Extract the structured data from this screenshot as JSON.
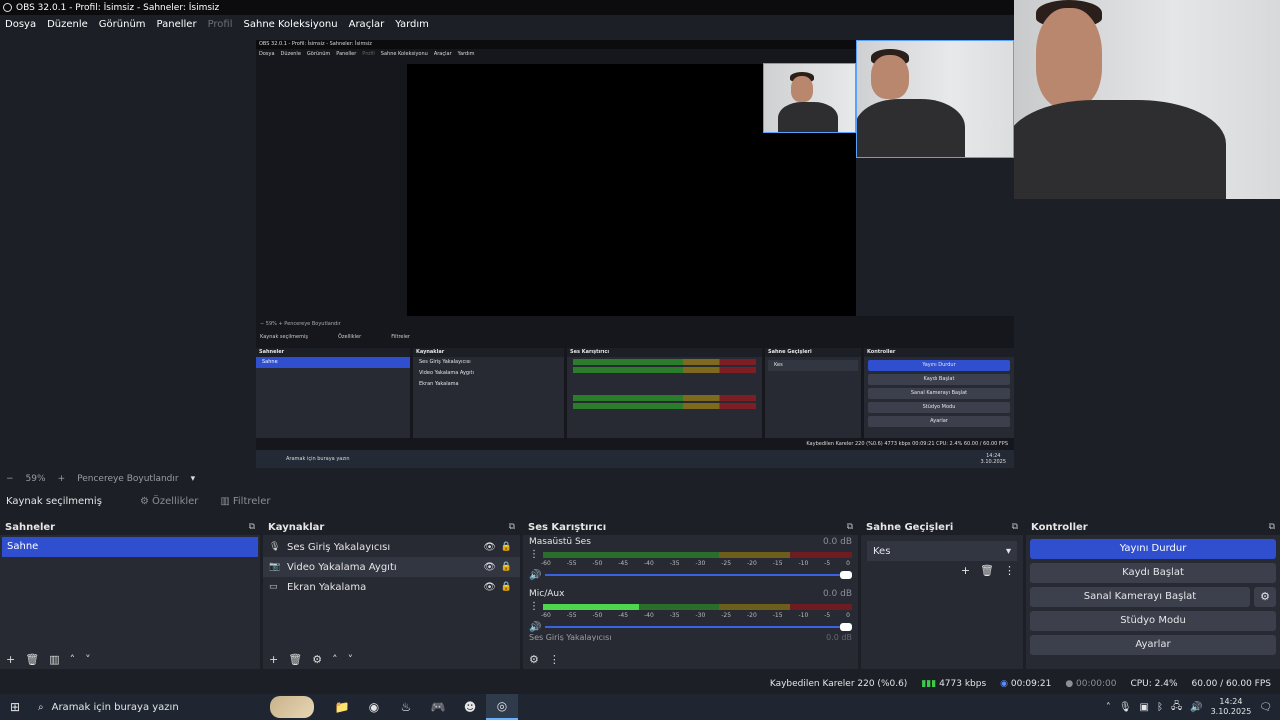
{
  "window": {
    "title": "OBS 32.0.1 - Profil: İsimsiz - Sahneler: İsimsiz"
  },
  "menu": {
    "items": [
      {
        "label": "Dosya",
        "disabled": false
      },
      {
        "label": "Düzenle",
        "disabled": false
      },
      {
        "label": "Görünüm",
        "disabled": false
      },
      {
        "label": "Paneller",
        "disabled": false
      },
      {
        "label": "Profil",
        "disabled": true
      },
      {
        "label": "Sahne Koleksiyonu",
        "disabled": false
      },
      {
        "label": "Araçlar",
        "disabled": false
      },
      {
        "label": "Yardım",
        "disabled": false
      }
    ]
  },
  "nested": {
    "title": "OBS 32.0.1 - Profil: İsimsiz - Sahneler: İsimsiz",
    "menu": [
      "Dosya",
      "Düzenle",
      "Görünüm",
      "Paneller",
      "Profil",
      "Sahne Koleksiyonu",
      "Araçlar",
      "Yardım"
    ],
    "zoom": "59%",
    "zoom_label": "Pencereye Boyutlandır",
    "no_source": "Kaynak seçilmemiş",
    "properties": "Özellikler",
    "filters": "Filtreler",
    "scenes_title": "Sahneler",
    "scene": "Sahne",
    "sources_title": "Kaynaklar",
    "sources": [
      "Ses Giriş Yakalayıcısı",
      "Video Yakalama Aygıtı",
      "Ekran Yakalama"
    ],
    "mixer_title": "Ses Karıştırıcı",
    "transitions_title": "Sahne Geçişleri",
    "transition": "Kes",
    "controls_title": "Kontroller",
    "controls": [
      "Yayını Durdur",
      "Kaydı Başlat",
      "Sanal Kamerayı Başlat",
      "Stüdyo Modu",
      "Ayarlar"
    ],
    "status": "Kaybedilen Kareler 220 (%0.6)   4773 kbps   00:09:21   CPU: 2.4%   60.00 / 60.00 FPS",
    "taskbar_search": "Aramak için buraya yazın",
    "clock_time": "14:24",
    "clock_date": "3.10.2025"
  },
  "zoom": {
    "minus": "−",
    "value": "59%",
    "plus": "+",
    "fit_label": "Pencereye Boyutlandır"
  },
  "source_bar": {
    "none_selected": "Kaynak seçilmemiş",
    "properties": "Özellikler",
    "filters": "Filtreler"
  },
  "scenes": {
    "title": "Sahneler",
    "items": [
      "Sahne"
    ]
  },
  "sources": {
    "title": "Kaynaklar",
    "items": [
      {
        "icon": "microphone-icon",
        "label": "Ses Giriş Yakalayıcısı"
      },
      {
        "icon": "camera-icon",
        "label": "Video Yakalama Aygıtı"
      },
      {
        "icon": "monitor-icon",
        "label": "Ekran Yakalama"
      }
    ]
  },
  "mixer": {
    "title": "Ses Karıştırıcı",
    "ticks": [
      "-60",
      "-55",
      "-50",
      "-45",
      "-40",
      "-35",
      "-30",
      "-25",
      "-20",
      "-15",
      "-10",
      "-5",
      "0"
    ],
    "channels": [
      {
        "name": "Masaüstü Ses",
        "db": "0.0 dB",
        "level": 0.0
      },
      {
        "name": "Mic/Aux",
        "db": "0.0 dB",
        "level": 0.31
      }
    ],
    "partial_channel": "Ses Giriş Yakalayıcısı",
    "partial_db": "0.0 dB"
  },
  "transitions": {
    "title": "Sahne Geçişleri",
    "selected": "Kes"
  },
  "controls": {
    "title": "Kontroller",
    "stop_stream": "Yayını Durdur",
    "start_recording": "Kaydı Başlat",
    "start_virtual_cam": "Sanal Kamerayı Başlat",
    "studio_mode": "Stüdyo Modu",
    "settings": "Ayarlar"
  },
  "status": {
    "dropped_frames": "Kaybedilen Kareler 220 (%0.6)",
    "bitrate": "4773 kbps",
    "stream_time": "00:09:21",
    "record_time": "00:00:00",
    "cpu": "CPU: 2.4%",
    "fps": "60.00 / 60.00 FPS"
  },
  "taskbar": {
    "search_placeholder": "Aramak için buraya yazın",
    "time": "14:24",
    "date": "3.10.2025"
  },
  "colors": {
    "accent": "#2f4fcf",
    "dock_bg": "#272a33",
    "app_bg": "#1d1f26",
    "signal": "#3ec94a"
  }
}
